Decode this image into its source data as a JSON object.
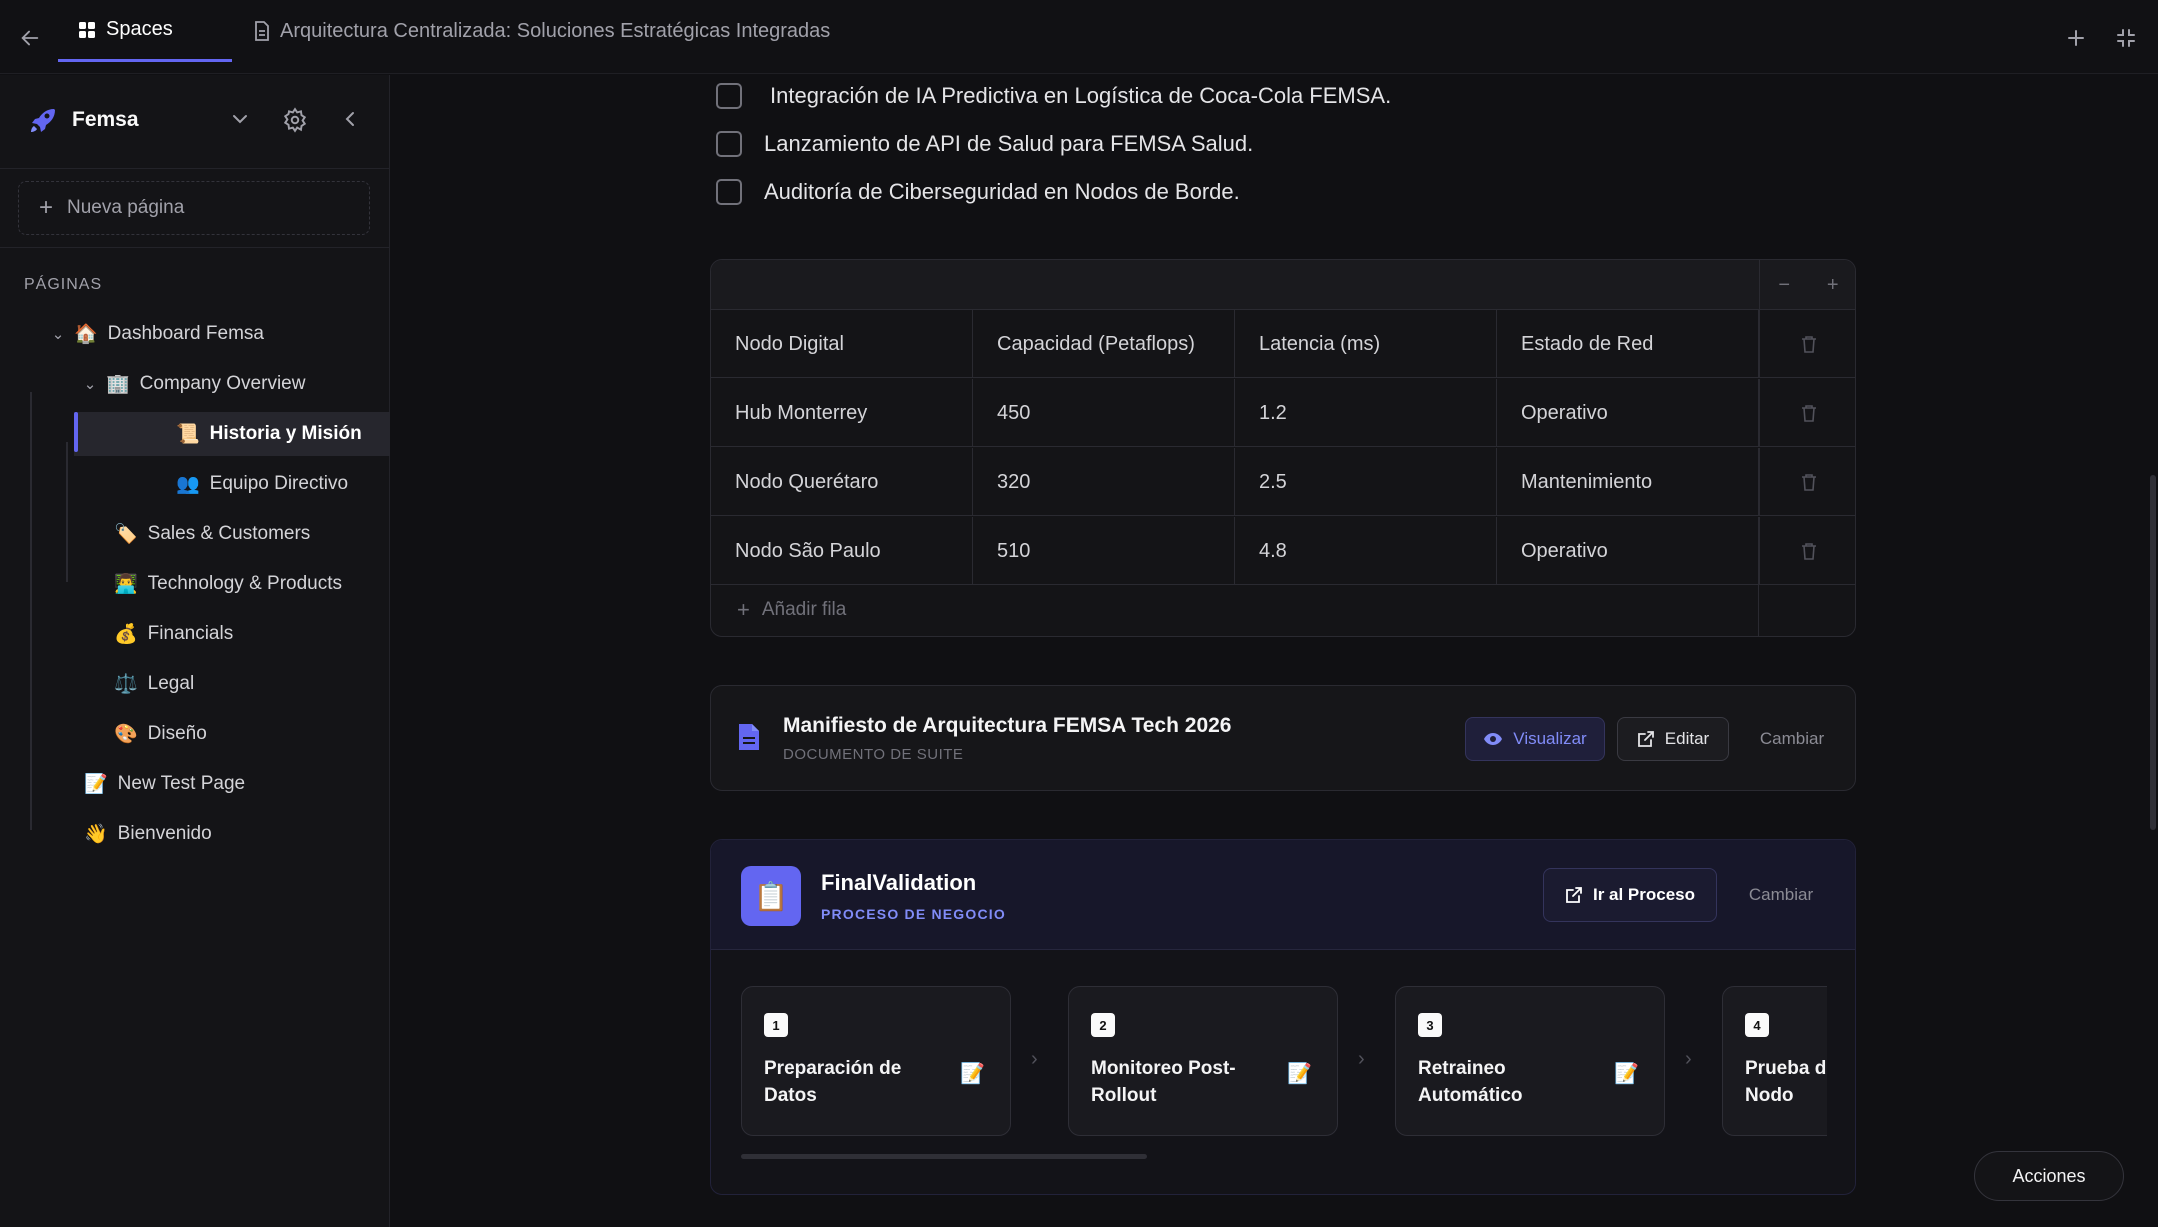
{
  "topbar": {
    "tab_spaces": "Spaces",
    "tab_document": "Arquitectura Centralizada: Soluciones Estratégicas Integradas"
  },
  "sidebar": {
    "workspace_name": "Femsa",
    "new_page": "Nueva página",
    "pages_label": "PÁGINAS",
    "items": [
      {
        "label": "Dashboard Femsa",
        "emoji": "🏠"
      },
      {
        "label": "Company Overview",
        "emoji": "🏢"
      },
      {
        "label": "Historia y Misión",
        "emoji": "📜"
      },
      {
        "label": "Equipo Directivo",
        "emoji": "👥"
      },
      {
        "label": "Sales & Customers",
        "emoji": "🏷️"
      },
      {
        "label": "Technology & Products",
        "emoji": "👨‍💻"
      },
      {
        "label": "Financials",
        "emoji": "💰"
      },
      {
        "label": "Legal",
        "emoji": "⚖️"
      },
      {
        "label": "Diseño",
        "emoji": "🎨"
      },
      {
        "label": "New Test Page",
        "emoji": "📝"
      },
      {
        "label": "Bienvenido",
        "emoji": "👋"
      }
    ]
  },
  "checklist": [
    "Integración de IA Predictiva en Logística de Coca-Cola FEMSA.",
    "Lanzamiento de API de Salud para FEMSA Salud.",
    "Auditoría de Ciberseguridad en Nodos de Borde."
  ],
  "table": {
    "headers": [
      "Nodo Digital",
      "Capacidad (Petaflops)",
      "Latencia (ms)",
      "Estado de Red"
    ],
    "rows": [
      [
        "Hub Monterrey",
        "450",
        "1.2",
        "Operativo"
      ],
      [
        "Nodo Querétaro",
        "320",
        "2.5",
        "Mantenimiento"
      ],
      [
        "Nodo São Paulo",
        "510",
        "4.8",
        "Operativo"
      ]
    ],
    "add_row": "Añadir fila"
  },
  "document": {
    "title": "Manifiesto de Arquitectura FEMSA Tech 2026",
    "subtitle": "DOCUMENTO DE SUITE",
    "view_label": "Visualizar",
    "edit_label": "Editar",
    "change_label": "Cambiar"
  },
  "process": {
    "title": "FinalValidation",
    "subtitle": "PROCESO DE NEGOCIO",
    "go_label": "Ir al Proceso",
    "change_label": "Cambiar",
    "icon": "📋",
    "steps": [
      {
        "num": "1",
        "name": "Preparación de Datos",
        "emoji": "📝"
      },
      {
        "num": "2",
        "name": "Monitoreo Post-Rollout",
        "emoji": "📝"
      },
      {
        "num": "3",
        "name": "Retraineo Automático",
        "emoji": "📝"
      },
      {
        "num": "4",
        "name": "Prueba de Nodo en Nodo",
        "emoji": "📝"
      }
    ]
  },
  "actions_label": "Acciones",
  "colors": {
    "accent": "#6366f1",
    "background": "#101013",
    "sidebar": "#141417"
  }
}
